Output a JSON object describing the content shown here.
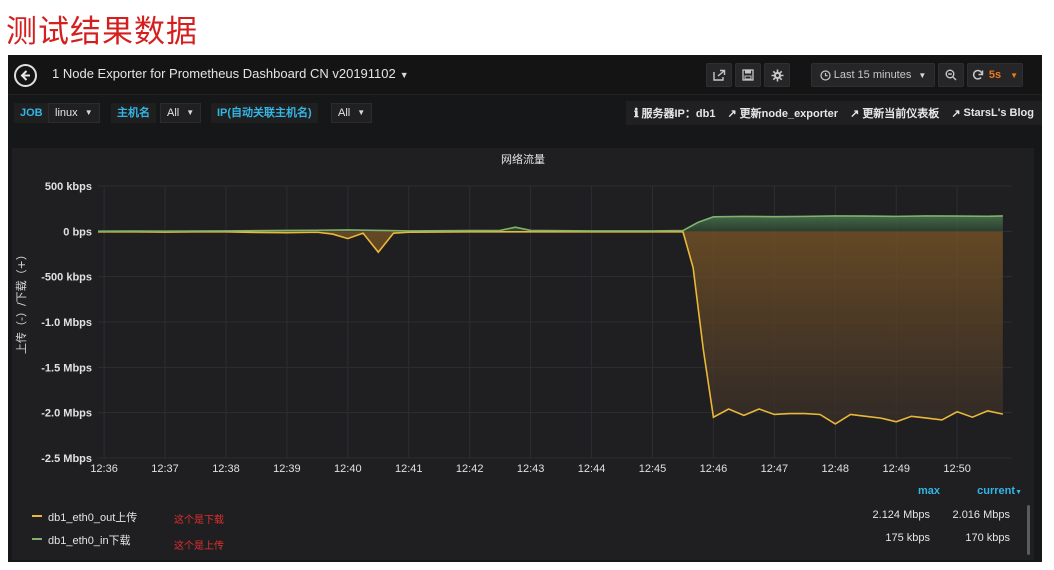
{
  "caption": "测试结果数据",
  "header": {
    "title": "1 Node Exporter for Prometheus Dashboard CN v20191102",
    "time_range": "Last 15 minutes",
    "refresh": "5s"
  },
  "variables": {
    "job_label": "JOB",
    "job_value": "linux",
    "host_label": "主机名",
    "host_value": "All",
    "ip_label": "IP(自动关联主机名)",
    "ip_value": "All"
  },
  "links": {
    "server_ip": "服务器IP：db1",
    "update_exporter": "更新node_exporter",
    "update_dashboard": "更新当前仪表板",
    "blog": "StarsL's Blog"
  },
  "panel": {
    "title": "网络流量",
    "y_axis_title": "上传（-）/下载（+）"
  },
  "legend": {
    "max_header": "max",
    "current_header": "current",
    "rows": [
      {
        "name": "db1_eth0_out上传",
        "note": "这个是下载",
        "max": "2.124 Mbps",
        "current": "2.016 Mbps",
        "color": "#eab839"
      },
      {
        "name": "db1_eth0_in下载",
        "note": "这个是上传",
        "max": "175 kbps",
        "current": "170 kbps",
        "color": "#7eb26d"
      }
    ]
  },
  "chart_data": {
    "type": "area",
    "title": "网络流量",
    "ylabel": "上传（-）/下载（+）",
    "y_unit": "bps",
    "ylim": [
      -2500000,
      500000
    ],
    "y_ticks": [
      {
        "v": 500000,
        "label": "500 kbps"
      },
      {
        "v": 0,
        "label": "0 bps"
      },
      {
        "v": -500000,
        "label": "-500 kbps"
      },
      {
        "v": -1000000,
        "label": "-1.0 Mbps"
      },
      {
        "v": -1500000,
        "label": "-1.5 Mbps"
      },
      {
        "v": -2000000,
        "label": "-2.0 Mbps"
      },
      {
        "v": -2500000,
        "label": "-2.5 Mbps"
      }
    ],
    "x_ticks": [
      "12:36",
      "12:37",
      "12:38",
      "12:39",
      "12:40",
      "12:41",
      "12:42",
      "12:43",
      "12:44",
      "12:45",
      "12:46",
      "12:47",
      "12:48",
      "12:49",
      "12:50"
    ],
    "grid": true,
    "series": [
      {
        "name": "db1_eth0_out上传",
        "color": "#eab839",
        "points": [
          [
            "12:35:54",
            -5000
          ],
          [
            "12:36:30",
            -5000
          ],
          [
            "12:37:00",
            -8000
          ],
          [
            "12:37:30",
            -5000
          ],
          [
            "12:38:00",
            -5000
          ],
          [
            "12:38:30",
            -12000
          ],
          [
            "12:39:00",
            -15000
          ],
          [
            "12:39:30",
            -10000
          ],
          [
            "12:39:45",
            -30000
          ],
          [
            "12:40:00",
            -80000
          ],
          [
            "12:40:15",
            -20000
          ],
          [
            "12:40:30",
            -230000
          ],
          [
            "12:40:45",
            -20000
          ],
          [
            "12:41:00",
            -10000
          ],
          [
            "12:42:00",
            -5000
          ],
          [
            "12:43:00",
            -5000
          ],
          [
            "12:44:00",
            -5000
          ],
          [
            "12:45:00",
            -5000
          ],
          [
            "12:45:30",
            -5000
          ],
          [
            "12:45:40",
            -400000
          ],
          [
            "12:45:50",
            -1300000
          ],
          [
            "12:46:00",
            -2050000
          ],
          [
            "12:46:15",
            -1960000
          ],
          [
            "12:46:30",
            -2030000
          ],
          [
            "12:46:45",
            -1960000
          ],
          [
            "12:47:00",
            -2020000
          ],
          [
            "12:47:15",
            -2010000
          ],
          [
            "12:47:30",
            -2010000
          ],
          [
            "12:47:45",
            -2020000
          ],
          [
            "12:48:00",
            -2124000
          ],
          [
            "12:48:15",
            -2020000
          ],
          [
            "12:48:30",
            -2040000
          ],
          [
            "12:48:45",
            -2060000
          ],
          [
            "12:49:00",
            -2100000
          ],
          [
            "12:49:15",
            -2040000
          ],
          [
            "12:49:30",
            -2060000
          ],
          [
            "12:49:45",
            -2080000
          ],
          [
            "12:50:00",
            -1990000
          ],
          [
            "12:50:15",
            -2050000
          ],
          [
            "12:50:30",
            -1980000
          ],
          [
            "12:50:45",
            -2016000
          ]
        ]
      },
      {
        "name": "db1_eth0_in下载",
        "color": "#7eb26d",
        "points": [
          [
            "12:35:54",
            2000
          ],
          [
            "12:36:30",
            3000
          ],
          [
            "12:37:00",
            2000
          ],
          [
            "12:38:00",
            5000
          ],
          [
            "12:39:00",
            10000
          ],
          [
            "12:39:30",
            12000
          ],
          [
            "12:40:00",
            15000
          ],
          [
            "12:40:30",
            10000
          ],
          [
            "12:41:00",
            5000
          ],
          [
            "12:42:00",
            8000
          ],
          [
            "12:42:30",
            10000
          ],
          [
            "12:42:45",
            45000
          ],
          [
            "12:43:00",
            10000
          ],
          [
            "12:44:00",
            5000
          ],
          [
            "12:45:00",
            5000
          ],
          [
            "12:45:30",
            8000
          ],
          [
            "12:45:45",
            100000
          ],
          [
            "12:46:00",
            160000
          ],
          [
            "12:46:30",
            165000
          ],
          [
            "12:47:00",
            162000
          ],
          [
            "12:47:30",
            165000
          ],
          [
            "12:48:00",
            170000
          ],
          [
            "12:48:30",
            168000
          ],
          [
            "12:49:00",
            165000
          ],
          [
            "12:49:30",
            170000
          ],
          [
            "12:50:00",
            168000
          ],
          [
            "12:50:30",
            166000
          ],
          [
            "12:50:45",
            170000
          ]
        ]
      }
    ]
  }
}
